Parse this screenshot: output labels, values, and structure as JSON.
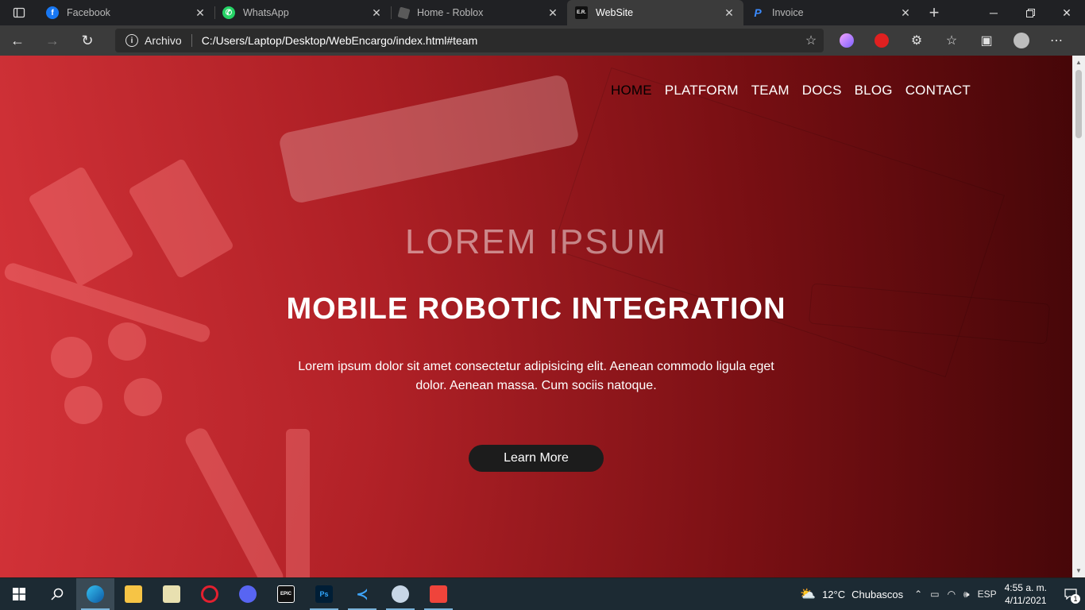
{
  "browser": {
    "tabs": [
      {
        "title": "Facebook",
        "icon": "facebook-icon",
        "color": "#1877f2",
        "glyph": "f"
      },
      {
        "title": "WhatsApp",
        "icon": "whatsapp-icon",
        "color": "#25d366",
        "glyph": "✆"
      },
      {
        "title": "Home - Roblox",
        "icon": "roblox-icon",
        "color": "#5a5a5a",
        "glyph": "■"
      },
      {
        "title": "WebSite",
        "icon": "website-favicon-icon",
        "color": "#111111",
        "glyph": "E.R."
      },
      {
        "title": "Invoice",
        "icon": "paypal-icon",
        "color": "#0070e0",
        "glyph": "P"
      }
    ],
    "active_tab_index": 3,
    "address": {
      "protocol_label": "Archivo",
      "url": "C:/Users/Laptop/Desktop/WebEncargo/index.html#team"
    }
  },
  "page": {
    "nav": [
      "HOME",
      "PLATFORM",
      "TEAM",
      "DOCS",
      "BLOG",
      "CONTACT"
    ],
    "nav_current": "HOME",
    "kicker": "LOREM IPSUM",
    "headline": "MOBILE ROBOTIC INTEGRATION",
    "lead": "Lorem ipsum dolor sit amet consectetur adipisicing elit. Aenean commodo ligula eget dolor. Aenean massa. Cum sociis natoque.",
    "cta_label": "Learn More",
    "accent": "#d63238"
  },
  "taskbar": {
    "weather": {
      "temp": "12°C",
      "condition": "Chubascos"
    },
    "language": "ESP",
    "time": "4:55 a. m.",
    "date": "4/11/2021",
    "notifications": "1"
  }
}
